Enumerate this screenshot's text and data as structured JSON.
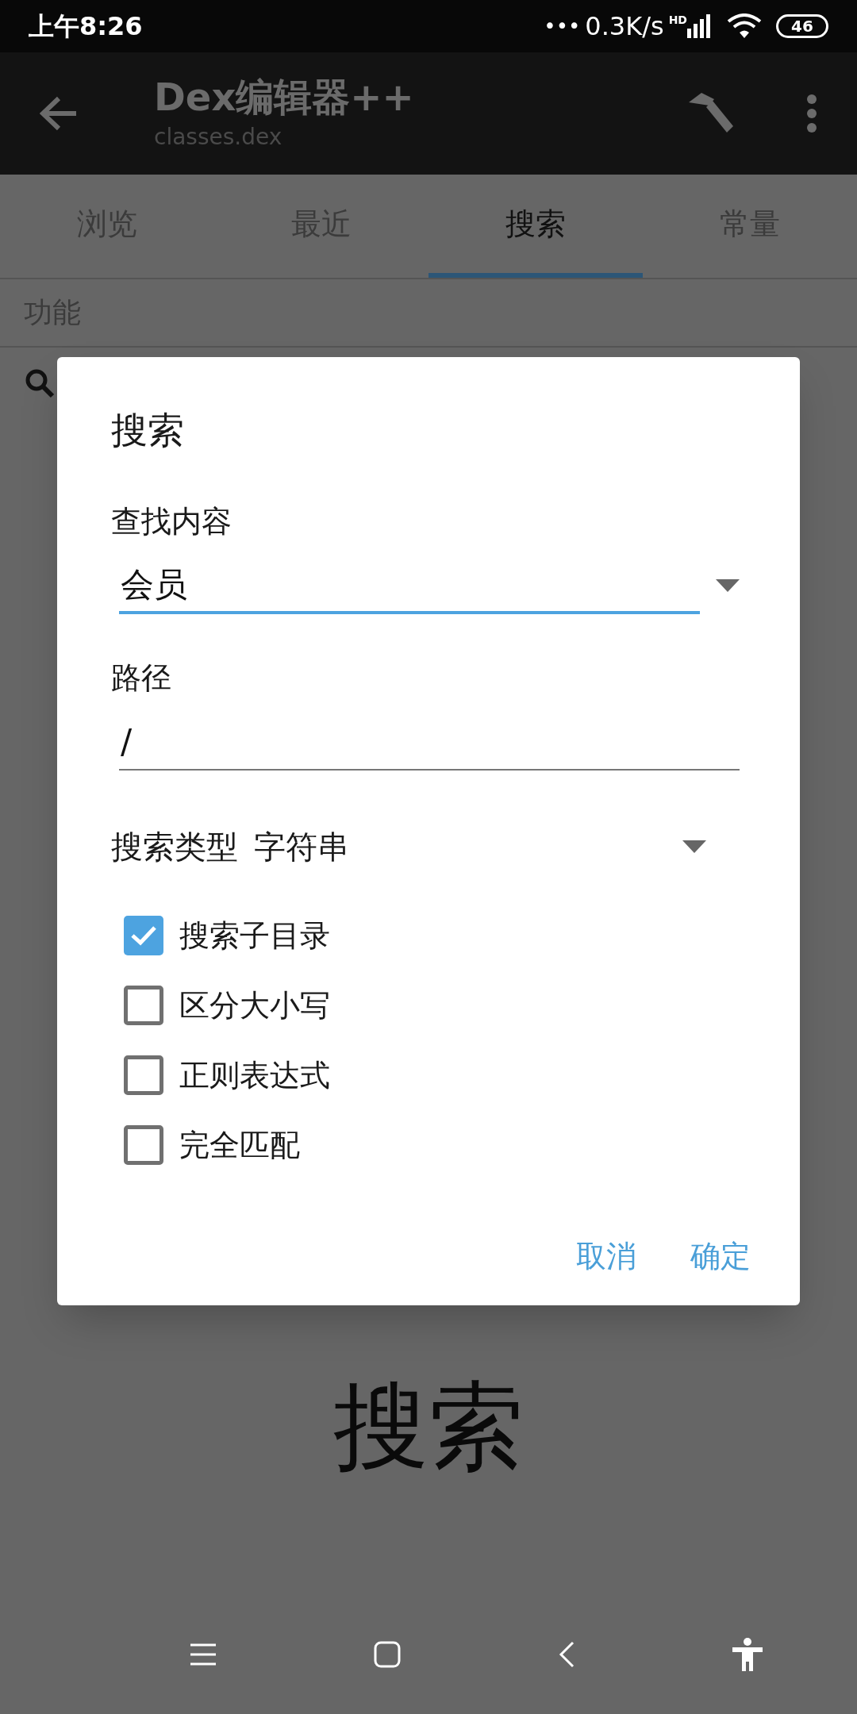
{
  "status_bar": {
    "time": "上午8:26",
    "dots": "•••",
    "speed": "0.3K/s",
    "signal_label": "HD",
    "battery": "46"
  },
  "app_bar": {
    "title": "Dex编辑器++",
    "subtitle": "classes.dex"
  },
  "tabs": [
    {
      "label": "浏览",
      "selected": false
    },
    {
      "label": "最近",
      "selected": false
    },
    {
      "label": "搜索",
      "selected": true
    },
    {
      "label": "常量",
      "selected": false
    }
  ],
  "section_header": "功能",
  "background_text": "搜索",
  "dialog": {
    "title": "搜索",
    "fields": [
      {
        "kind": "dropdown",
        "label": "查找内容",
        "value": "会员",
        "focused": true
      },
      {
        "kind": "text",
        "label": "路径",
        "value": "/",
        "focused": false
      }
    ],
    "search_type": {
      "label": "搜索类型",
      "value": "字符串"
    },
    "options": [
      {
        "label": "搜索子目录",
        "checked": true
      },
      {
        "label": "区分大小写",
        "checked": false
      },
      {
        "label": "正则表达式",
        "checked": false
      },
      {
        "label": "完全匹配",
        "checked": false
      }
    ],
    "buttons": [
      "取消",
      "确定"
    ]
  }
}
